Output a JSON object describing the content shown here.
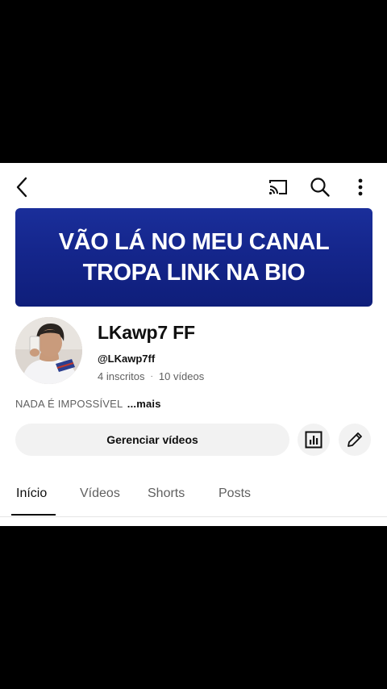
{
  "topbar": {
    "back_icon": "chevron-left-icon",
    "cast_icon": "cast-icon",
    "search_icon": "search-icon",
    "more_icon": "more-vertical-icon"
  },
  "banner": {
    "line1": "VÃO LÁ NO MEU CANAL",
    "line2": "TROPA LINK NA BIO",
    "background_color": "#15278c",
    "text_color": "#ffffff"
  },
  "channel": {
    "name": "LKawp7 FF",
    "handle": "@LKawp7ff",
    "subscribers": "4 inscritos",
    "separator": "·",
    "videos": "10 vídeos",
    "description": "NADA É IMPOSSÍVEL",
    "more_label": "...mais"
  },
  "actions": {
    "manage_label": "Gerenciar vídeos",
    "analytics_icon": "analytics-chart-icon",
    "edit_icon": "pencil-icon"
  },
  "tabs": [
    {
      "label": "Início",
      "active": true
    },
    {
      "label": "Vídeos",
      "active": false
    },
    {
      "label": "Shorts",
      "active": false
    },
    {
      "label": "Posts",
      "active": false
    }
  ]
}
